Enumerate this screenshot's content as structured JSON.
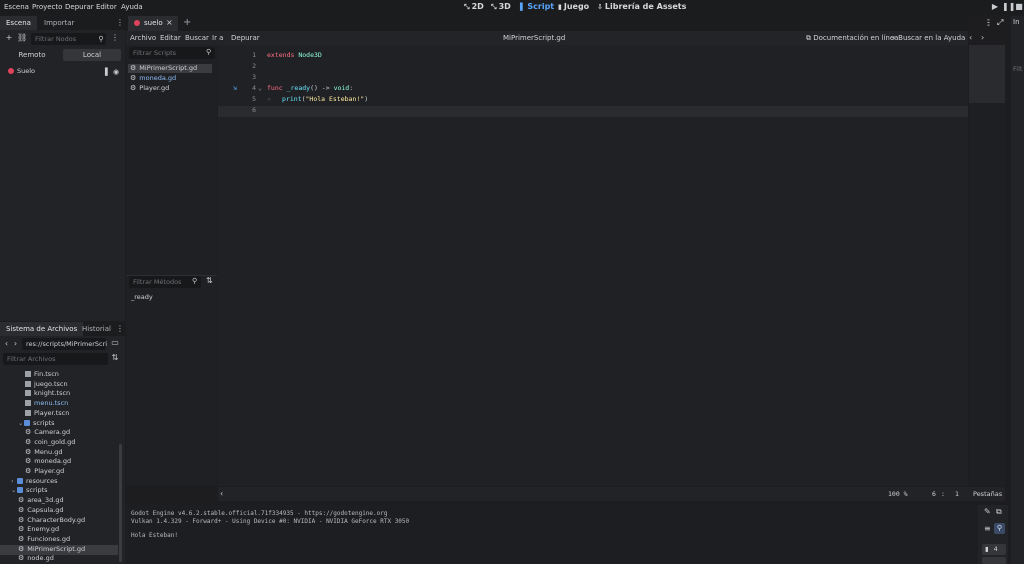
{
  "menu": [
    "Escena",
    "Proyecto",
    "Depurar",
    "Editor",
    "Ayuda"
  ],
  "workspaces": [
    {
      "label": "2D",
      "icon": "2d-icon",
      "active": false
    },
    {
      "label": "3D",
      "icon": "3d-icon",
      "active": false
    },
    {
      "label": "Script",
      "icon": "script-icon",
      "active": true
    },
    {
      "label": "Juego",
      "icon": "game-icon",
      "active": false
    },
    {
      "label": "Librería de Assets",
      "icon": "assetlib-icon",
      "active": false
    }
  ],
  "scene_dock": {
    "tabs": [
      "Escena",
      "Importar"
    ],
    "filter_placeholder": "Filtrar Nodos",
    "remote": "Remoto",
    "local": "Local",
    "root_node": "Suelo"
  },
  "fs_dock": {
    "tabs": [
      "Sistema de Archivos",
      "Historial"
    ],
    "path": "res://scripts/MiPrimerScri",
    "filter_placeholder": "Filtrar Archivos",
    "items": [
      {
        "name": "Fin.tscn",
        "type": "scene",
        "indent": 3
      },
      {
        "name": "juego.tscn",
        "type": "scene",
        "indent": 3
      },
      {
        "name": "knight.tscn",
        "type": "scene",
        "indent": 3
      },
      {
        "name": "menu.tscn",
        "type": "scene",
        "indent": 3,
        "highlight": true
      },
      {
        "name": "Player.tscn",
        "type": "scene",
        "indent": 3
      },
      {
        "name": "scripts",
        "type": "folder",
        "indent": 2,
        "open": true
      },
      {
        "name": "Camera.gd",
        "type": "script",
        "indent": 3
      },
      {
        "name": "coin_gold.gd",
        "type": "script",
        "indent": 3
      },
      {
        "name": "Menu.gd",
        "type": "script",
        "indent": 3
      },
      {
        "name": "moneda.gd",
        "type": "script",
        "indent": 3
      },
      {
        "name": "Player.gd",
        "type": "script",
        "indent": 3
      },
      {
        "name": "resources",
        "type": "folder",
        "indent": 1,
        "open": false
      },
      {
        "name": "scripts",
        "type": "folder",
        "indent": 1,
        "open": true
      },
      {
        "name": "area_3d.gd",
        "type": "script",
        "indent": 2
      },
      {
        "name": "Capsula.gd",
        "type": "script",
        "indent": 2
      },
      {
        "name": "CharacterBody.gd",
        "type": "script",
        "indent": 2
      },
      {
        "name": "Enemy.gd",
        "type": "script",
        "indent": 2
      },
      {
        "name": "Funciones.gd",
        "type": "script",
        "indent": 2
      },
      {
        "name": "MiPrimerScript.gd",
        "type": "script",
        "indent": 2,
        "selected": true
      },
      {
        "name": "node.gd",
        "type": "script",
        "indent": 2
      }
    ]
  },
  "scene_tab": {
    "label": "suelo"
  },
  "script_menu": [
    "Archivo",
    "Editar",
    "Buscar",
    "Ir a",
    "Depurar"
  ],
  "script_title": "MiPrimerScript.gd",
  "doc_online": "Documentación en línea",
  "search_help": "Buscar en la Ayuda",
  "scripts_filter_placeholder": "Filtrar Scripts",
  "scripts_list": [
    {
      "name": "MiPrimerScript.gd",
      "selected": true,
      "color": "#cfd2d6"
    },
    {
      "name": "moneda.gd",
      "selected": false,
      "color": "#8fbef7"
    },
    {
      "name": "Player.gd",
      "selected": false,
      "color": "#cfd2d6"
    }
  ],
  "methods_filter_placeholder": "Filtrar Métodos",
  "methods": [
    "_ready"
  ],
  "code": {
    "line_numbers": [
      "1",
      "2",
      "3",
      "4",
      "5",
      "6"
    ],
    "l1_kw": "extends",
    "l1_type": "Node3D",
    "l4_kw": "func",
    "l4_fn": "_ready",
    "l4_rest": "() ->",
    "l4_type": "void",
    "l5_fn": "print",
    "l5_open": "(",
    "l5_str": "\"Hola Esteban!\"",
    "l5_close": ")"
  },
  "status": {
    "zoom": "100 %",
    "line": "6",
    "col": "1",
    "indent": "Pestañas"
  },
  "output": {
    "lines": [
      "Godot Engine v4.6.2.stable.official.71f334935 - https://godotengine.org",
      "Vulkan 1.4.329 - Forward+ - Using Device #0: NVIDIA - NVIDIA GeForce RTX 3050",
      "",
      "Hola Esteban!"
    ],
    "badge": "4"
  },
  "right_dock": {
    "tab": "In",
    "filter": "Filt"
  },
  "colors": {
    "accent": "#5aa6ff",
    "keyword": "#ff7085",
    "type": "#8effda",
    "function": "#66e6ff",
    "string": "#ffeda1"
  }
}
